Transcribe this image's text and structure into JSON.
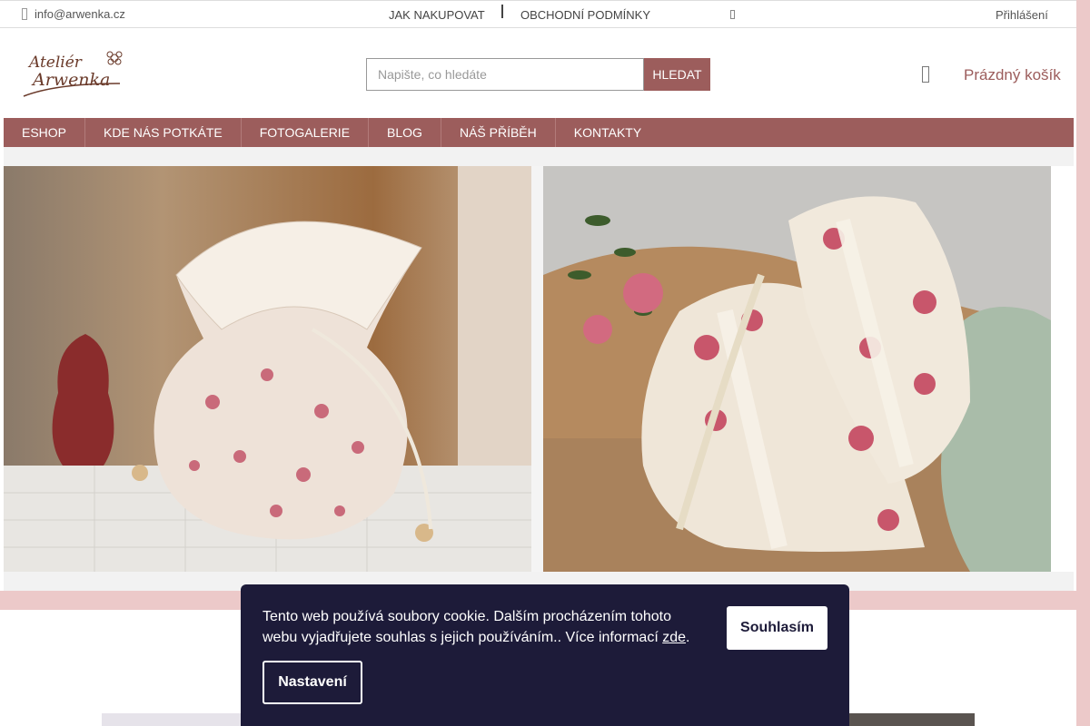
{
  "topbar": {
    "email": "info@arwenka.cz",
    "links": [
      "JAK NAKUPOVAT",
      "OBCHODNÍ PODMÍNKY"
    ],
    "login": "Přihlášení"
  },
  "header": {
    "logo_text": "Ateliér Arwenka",
    "search_placeholder": "Napište, co hledáte",
    "search_button": "HLEDAT",
    "cart": "Prázdný košík"
  },
  "nav": [
    "ESHOP",
    "KDE NÁS POTKÁTE",
    "FOTOGALERIE",
    "BLOG",
    "NÁŠ PŘÍBĚH",
    "KONTAKTY"
  ],
  "cookie": {
    "text": "Tento web používá soubory cookie. Dalším procházením tohoto webu vyjadřujete souhlas s jejich používáním.. Více informací ",
    "link": "zde",
    "after_link": ".",
    "accept": "Souhlasím",
    "settings": "Nastavení"
  }
}
